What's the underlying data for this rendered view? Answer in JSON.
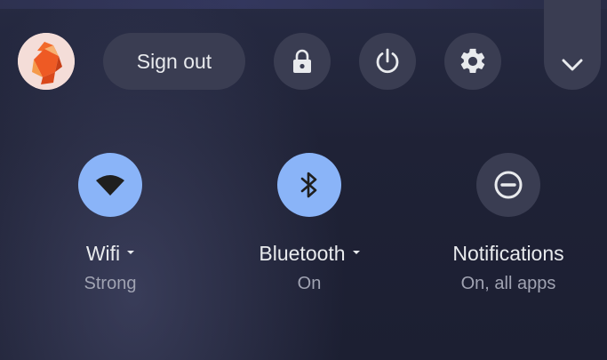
{
  "top_bar": {
    "avatar_icon": "fox-avatar-icon",
    "sign_out_label": "Sign out",
    "lock_icon": "lock-icon",
    "power_icon": "power-icon",
    "settings_icon": "gear-icon",
    "collapse_icon": "chevron-down-icon"
  },
  "pods": [
    {
      "label": "Wifi",
      "sublabel": "Strong",
      "icon": "wifi-icon",
      "state": "on",
      "has_menu": true
    },
    {
      "label": "Bluetooth",
      "sublabel": "On",
      "icon": "bluetooth-icon",
      "state": "on",
      "has_menu": true
    },
    {
      "label": "Notifications",
      "sublabel": "On, all apps",
      "icon": "do-not-disturb-icon",
      "state": "off",
      "has_menu": false
    }
  ],
  "colors": {
    "accent": "#8ab4f8",
    "button_bg": "#3a3d52",
    "text": "#e8eaed",
    "subtext": "#a0a3b2"
  }
}
